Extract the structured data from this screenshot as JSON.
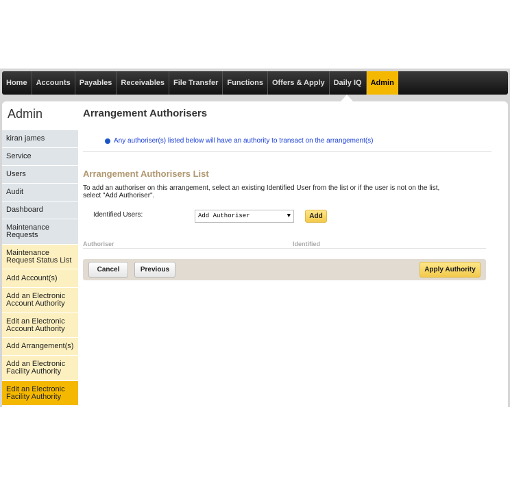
{
  "nav": [
    "Home",
    "Accounts",
    "Payables",
    "Receivables",
    "File Transfer",
    "Functions",
    "Offers & Apply",
    "Daily IQ",
    "Admin"
  ],
  "nav_active": "Admin",
  "sidebar": {
    "title": "Admin",
    "items": [
      {
        "label": "kiran james",
        "style": "g"
      },
      {
        "label": "Service",
        "style": "g"
      },
      {
        "label": "Users",
        "style": "g"
      },
      {
        "label": "Audit",
        "style": "g"
      },
      {
        "label": "Dashboard",
        "style": "g"
      },
      {
        "label": "Maintenance Requests",
        "style": "g"
      },
      {
        "label": "Maintenance Request Status List",
        "style": "y"
      },
      {
        "label": "Add Account(s)",
        "style": "y"
      },
      {
        "label": "Add an Electronic Account Authority",
        "style": "y"
      },
      {
        "label": "Edit an Electronic Account Authority",
        "style": "y"
      },
      {
        "label": "Add Arrangement(s)",
        "style": "y"
      },
      {
        "label": "Add an Electronic Facility Authority",
        "style": "y"
      },
      {
        "label": "Edit an Electronic Facility Authority",
        "style": "s"
      }
    ]
  },
  "main": {
    "title": "Arrangement Authorisers",
    "info": "Any authoriser(s) listed below will have an authority to transact on the arrangement(s)",
    "list_title": "Arrangement Authorisers List",
    "description": "To add an authoriser on this arrangement, select an existing Identified User from the list or if the user is not on the list, select \"Add Authoriser\".",
    "identified_label": "Identified Users:",
    "select_value": "Add Authoriser",
    "add_button": "Add",
    "columns": [
      "Authoriser",
      "Identified"
    ],
    "cancel": "Cancel",
    "previous": "Previous",
    "apply": "Apply Authority"
  },
  "colors": {
    "accent": "#f5b800",
    "info": "#1a3fd6"
  }
}
